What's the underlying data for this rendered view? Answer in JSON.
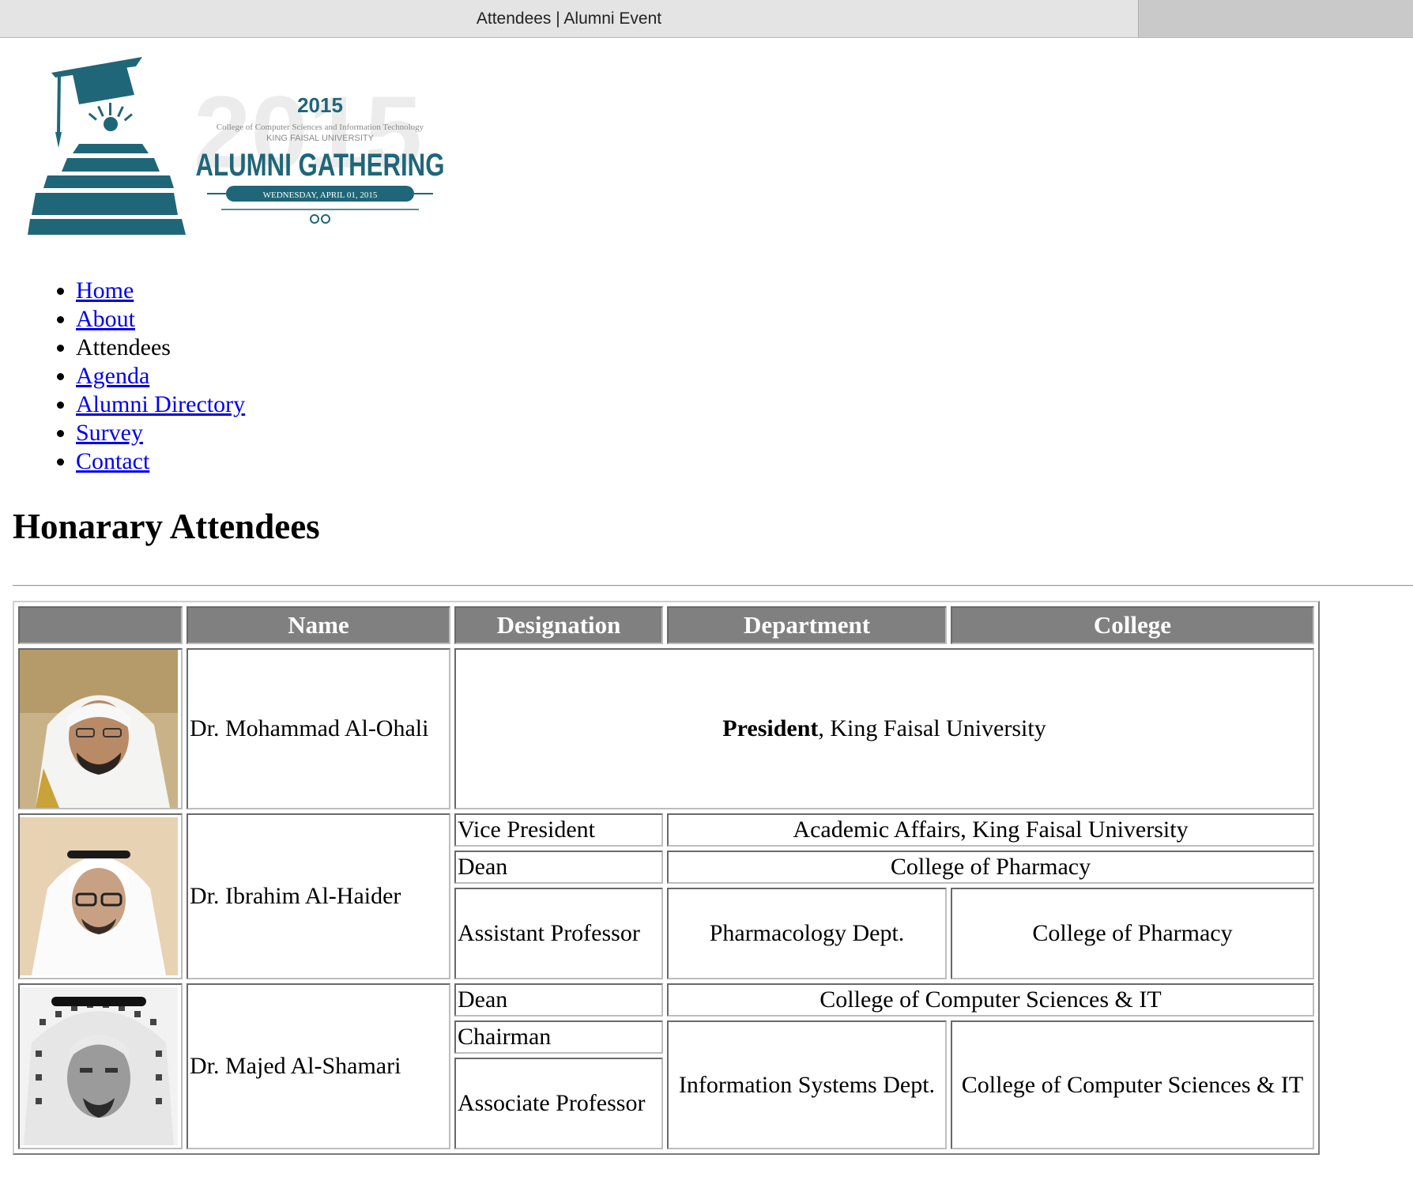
{
  "browser": {
    "tab_title": "Attendees | Alumni Event"
  },
  "logo": {
    "year": "2015",
    "line1": "College of Computer Sciences and Information Technology",
    "line2": "KING FAISAL UNIVERSITY",
    "title": "ALUMNI GATHERING",
    "date": "WEDNESDAY, APRIL 01, 2015",
    "color": "#1f6678"
  },
  "nav": {
    "items": [
      {
        "label": "Home",
        "link": true
      },
      {
        "label": "About",
        "link": true
      },
      {
        "label": "Attendees",
        "link": false
      },
      {
        "label": "Agenda",
        "link": true
      },
      {
        "label": "Alumni Directory",
        "link": true
      },
      {
        "label": "Survey",
        "link": true
      },
      {
        "label": "Contact",
        "link": true
      }
    ]
  },
  "page": {
    "heading": "Honarary Attendees"
  },
  "table": {
    "headers": [
      "",
      "Name",
      "Designation",
      "Department",
      "College"
    ],
    "rows": [
      {
        "name": "Dr. Mohammad Al-Ohali",
        "photo_icon": "person-photo",
        "president_bold": "President",
        "president_rest": ", King Faisal University"
      },
      {
        "name": "Dr. Ibrahim Al-Haider",
        "photo_icon": "person-photo",
        "roles": [
          {
            "designation": "Vice President",
            "dept_college": "Academic Affairs, King Faisal University"
          },
          {
            "designation": "Dean",
            "dept_college": "College of Pharmacy"
          },
          {
            "designation": "Assistant Professor",
            "department": "Pharmacology Dept.",
            "college": "College of Pharmacy"
          }
        ]
      },
      {
        "name": "Dr. Majed Al-Shamari",
        "photo_icon": "person-photo",
        "roles": [
          {
            "designation": "Dean",
            "dept_college": "College of Computer Sciences & IT"
          },
          {
            "designation": "Chairman"
          },
          {
            "designation": "Associate Professor"
          }
        ],
        "department": "Information Systems Dept.",
        "college": "College of Computer Sciences & IT"
      }
    ]
  }
}
